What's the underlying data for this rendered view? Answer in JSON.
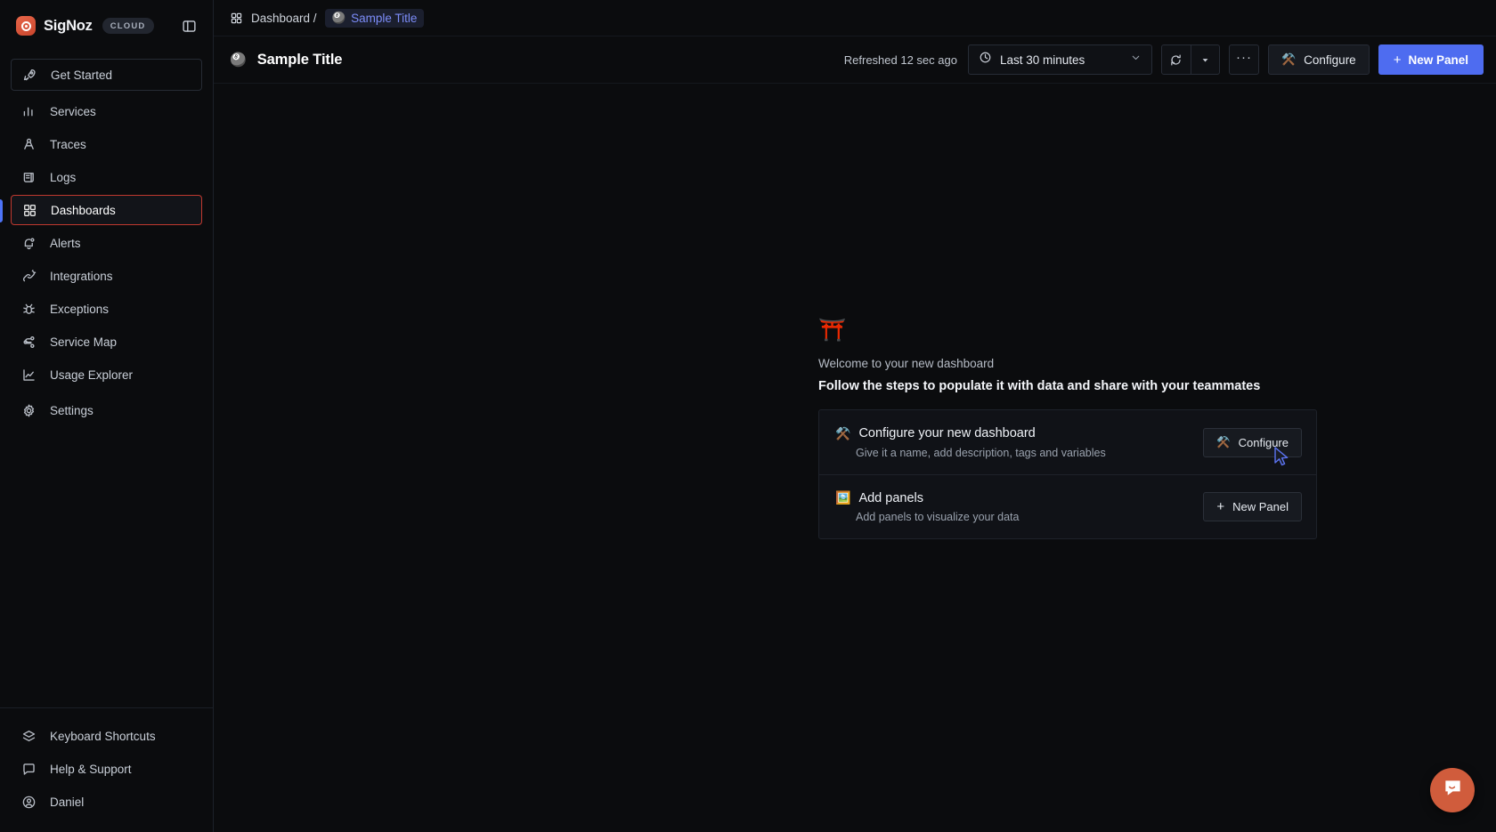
{
  "brand": {
    "name": "SigNoz",
    "badge": "CLOUD",
    "logo_icon": "signoz-eye-logo",
    "collapse_icon": "panel-collapse-icon",
    "accent_color": "#d4563a"
  },
  "sidebar": {
    "primary_items": [
      {
        "label": "Get Started",
        "icon": "rocket-icon",
        "style": "boxed",
        "name": "get-started"
      },
      {
        "label": "Services",
        "icon": "bar-chart-icon",
        "style": "plain",
        "name": "services"
      },
      {
        "label": "Traces",
        "icon": "traces-icon",
        "style": "plain",
        "name": "traces"
      },
      {
        "label": "Logs",
        "icon": "logs-icon",
        "style": "plain",
        "name": "logs"
      },
      {
        "label": "Dashboards",
        "icon": "grid-icon",
        "style": "highlight",
        "name": "dashboards"
      },
      {
        "label": "Alerts",
        "icon": "bell-icon",
        "style": "plain",
        "name": "alerts"
      },
      {
        "label": "Integrations",
        "icon": "integrations-icon",
        "style": "plain",
        "name": "integrations"
      },
      {
        "label": "Exceptions",
        "icon": "bug-icon",
        "style": "plain",
        "name": "exceptions"
      },
      {
        "label": "Service Map",
        "icon": "service-map-icon",
        "style": "plain",
        "name": "service-map"
      },
      {
        "label": "Usage Explorer",
        "icon": "usage-chart-icon",
        "style": "plain",
        "name": "usage-explorer"
      },
      {
        "label": "Settings",
        "icon": "gear-icon",
        "style": "plain",
        "name": "settings"
      }
    ],
    "footer_items": [
      {
        "label": "Keyboard Shortcuts",
        "icon": "layers-icon",
        "name": "keyboard-shortcuts"
      },
      {
        "label": "Help & Support",
        "icon": "message-icon",
        "name": "help-support"
      },
      {
        "label": "Daniel",
        "icon": "user-circle-icon",
        "name": "user-account"
      }
    ]
  },
  "breadcrumb": {
    "root_icon": "grid-icon",
    "root_label": "Dashboard /",
    "current_emoji": "🎱",
    "current_label": "Sample Title"
  },
  "header": {
    "emoji": "🎱",
    "title": "Sample Title",
    "refreshed_text": "Refreshed 12 sec ago",
    "time_range": {
      "icon": "clock-icon",
      "value": "Last 30 minutes",
      "caret_icon": "chevron-down-icon"
    },
    "refresh_icon": "refresh-icon",
    "refresh_caret_icon": "caret-down-icon",
    "more_label": "···",
    "configure_label": "Configure",
    "configure_emoji": "⚒️",
    "new_panel_label": "New Panel",
    "new_panel_plus": "+",
    "new_panel_color": "#4e6cf0"
  },
  "welcome": {
    "emoji": "⛩️",
    "subtitle": "Welcome to your new dashboard",
    "heading": "Follow the steps to populate it with data and share with your teammates",
    "steps": [
      {
        "emoji": "⚒️",
        "title": "Configure your new dashboard",
        "description": "Give it a name, add description, tags and variables",
        "button_label": "Configure",
        "button_emoji": "⚒️",
        "name": "configure-step"
      },
      {
        "emoji": "🖼️",
        "title": "Add panels",
        "description": "Add panels to visualize your data",
        "button_label": "New Panel",
        "button_emoji": "+",
        "name": "add-panels-step"
      }
    ]
  },
  "intercom": {
    "icon": "chat-bubble-icon",
    "color": "#d05c3c"
  }
}
